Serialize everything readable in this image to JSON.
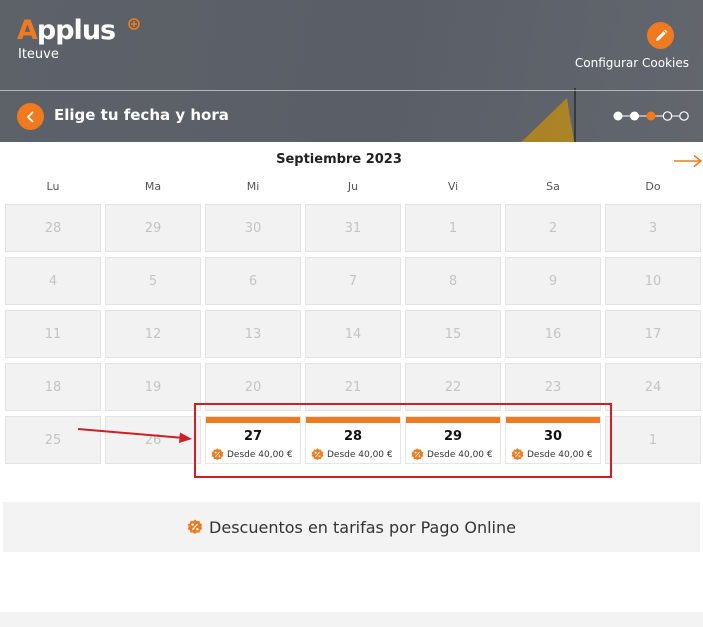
{
  "header": {
    "logo_text_accent": "A",
    "logo_text_rest": "pplus",
    "logo_subtitle": "Iteuve",
    "cookies_label": "Configurar Cookies",
    "step_title": "Elige tu fecha y hora",
    "progress": {
      "total_steps": 5,
      "completed_steps": 2,
      "current_step": 3
    }
  },
  "calendar": {
    "month_title": "Septiembre 2023",
    "weekdays": [
      "Lu",
      "Ma",
      "Mi",
      "Ju",
      "Vi",
      "Sa",
      "Do"
    ],
    "weeks": [
      [
        "28",
        "29",
        "30",
        "31",
        "1",
        "2",
        "3"
      ],
      [
        "4",
        "5",
        "6",
        "7",
        "8",
        "9",
        "10"
      ],
      [
        "11",
        "12",
        "13",
        "14",
        "15",
        "16",
        "17"
      ],
      [
        "18",
        "19",
        "20",
        "21",
        "22",
        "23",
        "24"
      ],
      [
        "25",
        "26",
        "27",
        "28",
        "29",
        "30",
        "1"
      ]
    ],
    "available": [
      {
        "day": "27",
        "price": "Desde 40,00 €"
      },
      {
        "day": "28",
        "price": "Desde 40,00 €"
      },
      {
        "day": "29",
        "price": "Desde 40,00 €"
      },
      {
        "day": "30",
        "price": "Desde 40,00 €"
      }
    ]
  },
  "discount_banner": {
    "text": "Descuentos en tarifas por Pago Online"
  },
  "colors": {
    "accent": "#f07a1f",
    "header_bg": "#5d6168",
    "highlight": "#cf1f25",
    "disabled_cell": "#f2f2f2"
  },
  "icons": [
    "pencil-icon",
    "back-arrow-icon",
    "next-month-arrow-icon",
    "discount-badge-icon",
    "logo-plus-icon"
  ]
}
